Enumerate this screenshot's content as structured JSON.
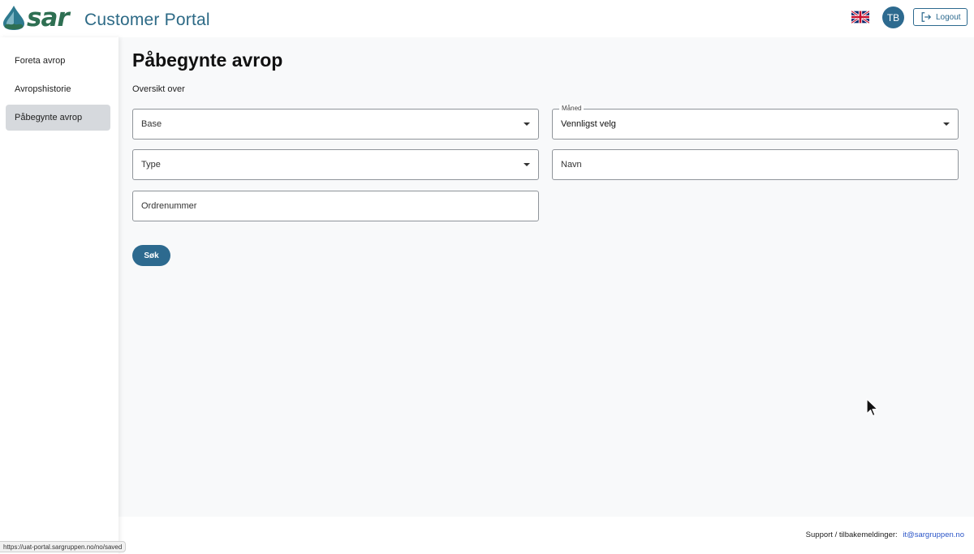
{
  "header": {
    "logo_text": "sar",
    "portal_title": "Customer Portal",
    "avatar_initials": "TB",
    "logout_label": "Logout"
  },
  "sidebar": {
    "items": [
      {
        "label": "Foreta avrop",
        "active": false
      },
      {
        "label": "Avropshistorie",
        "active": false
      },
      {
        "label": "Påbegynte avrop",
        "active": true
      }
    ]
  },
  "main": {
    "title": "Påbegynte avrop",
    "subtitle": "Oversikt over",
    "fields": {
      "base": {
        "placeholder": "Base"
      },
      "month": {
        "label": "Måned",
        "value": "Vennligst velg"
      },
      "type": {
        "placeholder": "Type"
      },
      "name": {
        "placeholder": "Navn"
      },
      "order_number": {
        "placeholder": "Ordrenummer"
      }
    },
    "search_button": "Søk"
  },
  "footer": {
    "support_label": "Support / tilbakemeldinger:",
    "support_email": "it@sargruppen.no"
  },
  "status_url": "https://uat-portal.sargruppen.no/no/saved",
  "colors": {
    "accent": "#2d6a8f",
    "brand_green": "#2e6f52",
    "active_nav": "#d6d9dd"
  },
  "icons": {
    "flag": "uk-flag-icon",
    "logout": "logout-icon"
  }
}
